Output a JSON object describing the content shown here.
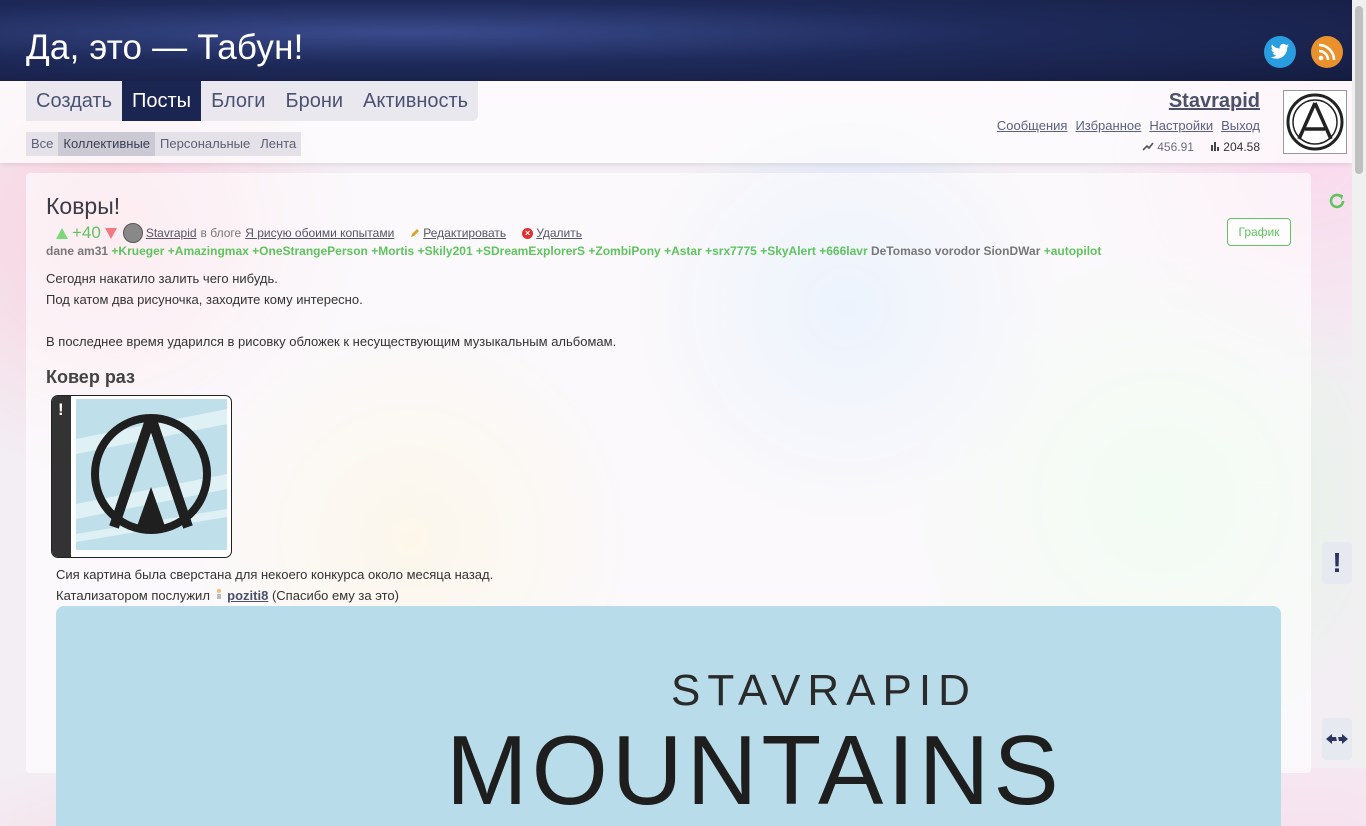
{
  "site": {
    "title": "Да, это — Табун!"
  },
  "colors": {
    "header_bg": "#1e2a5a",
    "nav_active": "#1b2552",
    "positive": "#5ec45e",
    "negative": "#f07a80",
    "twitter": "#2a9de0",
    "rss": "#e8912d"
  },
  "nav": {
    "main": [
      "Создать",
      "Посты",
      "Блоги",
      "Брони",
      "Активность"
    ],
    "main_active": "Посты",
    "sub": [
      "Все",
      "Коллективные",
      "Персональные",
      "Лента"
    ],
    "sub_active": "Коллективные"
  },
  "user": {
    "name": "Stavrapid",
    "menu": [
      "Сообщения",
      "Избранное",
      "Настройки",
      "Выход"
    ],
    "rating": "456.91",
    "force": "204.58"
  },
  "post": {
    "title": "Ковры!",
    "score": "+40",
    "author": "Stavrapid",
    "in_blog_label": "в блоге",
    "blog": "Я рисую обоими копытами",
    "edit_label": "Редактировать",
    "delete_label": "Удалить",
    "graph_label": "График",
    "voters": [
      {
        "name": "dane",
        "positive": false
      },
      {
        "name": "am31",
        "positive": false
      },
      {
        "name": "+Krueger",
        "positive": true
      },
      {
        "name": "+Amazingmax",
        "positive": true
      },
      {
        "name": "+OneStrangePerson",
        "positive": true
      },
      {
        "name": "+Mortis",
        "positive": true
      },
      {
        "name": "+Skily201",
        "positive": true
      },
      {
        "name": "+SDreamExplorerS",
        "positive": true
      },
      {
        "name": "+ZombiPony",
        "positive": true
      },
      {
        "name": "+Astar",
        "positive": true
      },
      {
        "name": "+srx7775",
        "positive": true
      },
      {
        "name": "+SkyAlert",
        "positive": true
      },
      {
        "name": "+666lavr",
        "positive": true
      },
      {
        "name": "DeTomaso",
        "positive": false
      },
      {
        "name": "vorodor",
        "positive": false
      },
      {
        "name": "SionDWar",
        "positive": false
      },
      {
        "name": "+autopilot",
        "positive": true
      }
    ],
    "text_line1": "Сегодня накатило залить чего нибудь.",
    "text_line2": "Под катом два рисуночка, заходите кому интересно.",
    "text_line3": "В последнее время ударился в рисовку обложек к несуществующим музыкальным альбомам.",
    "cover_heading": "Ковер раз",
    "spoiler_mark": "!",
    "caption1": "Сия картина была сверстана для некоего конкурса около месяца назад.",
    "catalyst_prefix": "Катализатором послужил",
    "catalyst_user": "poziti8",
    "catalyst_suffix": "(Спасибо ему за это)",
    "hero_artist": "STAVRAPID",
    "hero_album": "MOUNTAINS"
  },
  "side": {
    "warn_label": "!"
  }
}
